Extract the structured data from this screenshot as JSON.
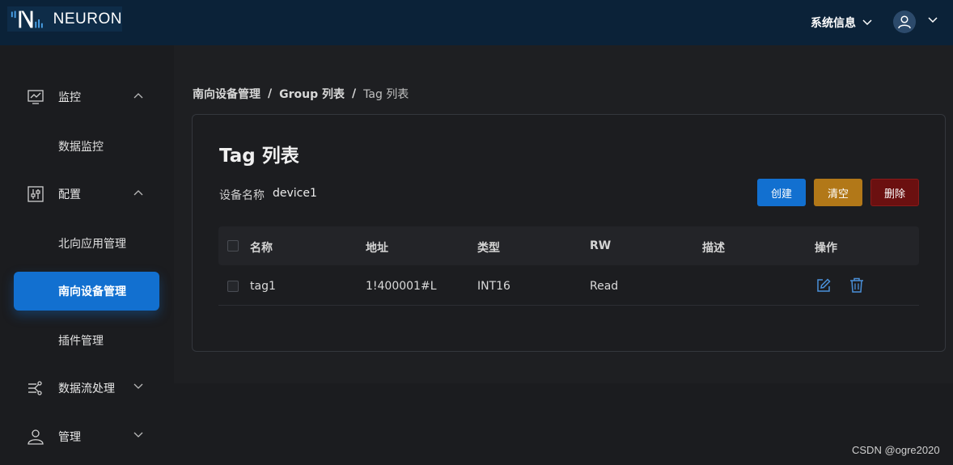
{
  "header": {
    "logo_text": "NEURON",
    "system_info_label": "系统信息",
    "icons": {
      "user": "user-icon",
      "chevron": "chevron-down-icon"
    }
  },
  "sidebar": {
    "groups": [
      {
        "label": "监控",
        "icon": "monitor-icon",
        "expanded": true,
        "items": [
          "数据监控"
        ]
      },
      {
        "label": "配置",
        "icon": "config-icon",
        "expanded": true,
        "items": [
          "北向应用管理",
          "南向设备管理",
          "插件管理"
        ]
      },
      {
        "label": "数据流处理",
        "icon": "dataflow-icon",
        "expanded": false,
        "items": []
      },
      {
        "label": "管理",
        "icon": "user-icon",
        "expanded": false,
        "items": []
      }
    ],
    "active_item": "南向设备管理"
  },
  "breadcrumb": {
    "items": [
      "南向设备管理",
      "Group 列表",
      "Tag 列表"
    ],
    "separator": "/"
  },
  "card": {
    "title": "Tag 列表",
    "device_label": "设备名称",
    "device_value": "device1",
    "buttons": {
      "create": "创建",
      "clear": "清空",
      "delete": "删除"
    }
  },
  "table": {
    "columns": [
      "名称",
      "地址",
      "类型",
      "RW",
      "描述",
      "操作"
    ],
    "rows": [
      {
        "name": "tag1",
        "address": "1!400001#L",
        "type": "INT16",
        "rw": "Read",
        "description": ""
      }
    ]
  },
  "watermark": "CSDN @ogre2020",
  "colors": {
    "header_bg": "#0b2238",
    "primary": "#1270d0",
    "warning": "#b27818",
    "danger": "#6b1010",
    "action_icon": "#4a90d9"
  }
}
